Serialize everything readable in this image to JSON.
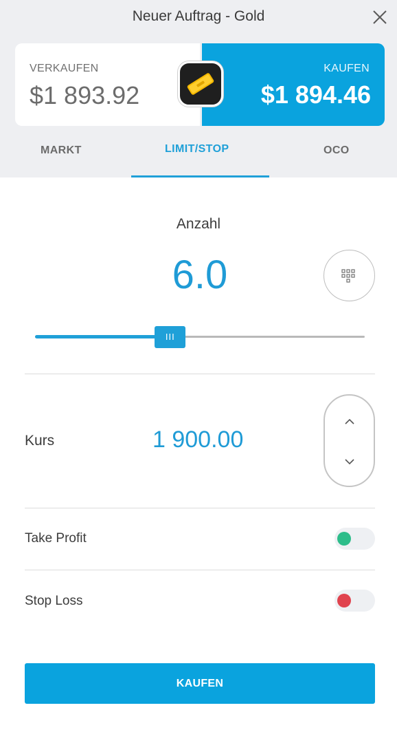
{
  "header": {
    "title": "Neuer Auftrag - Gold"
  },
  "prices": {
    "sell_label": "VERKAUFEN",
    "sell_price": "$1 893.92",
    "buy_label": "KAUFEN",
    "buy_price": "$1 894.46"
  },
  "tabs": [
    {
      "label": "MARKT"
    },
    {
      "label": "LIMIT/STOP",
      "active": true
    },
    {
      "label": "OCO"
    }
  ],
  "quantity": {
    "label": "Anzahl",
    "value": "6.0",
    "slider_fraction": 0.41,
    "thumb_glyph": "III"
  },
  "rate": {
    "label": "Kurs",
    "value": "1 900.00"
  },
  "take_profit": {
    "label": "Take Profit",
    "indicator_color": "#2dbd8a"
  },
  "stop_loss": {
    "label": "Stop Loss",
    "indicator_color": "#e0434e"
  },
  "submit": {
    "label": "KAUFEN"
  },
  "colors": {
    "accent": "#0aa3de",
    "value_blue": "#1f9bd6"
  },
  "icons": {
    "close": "close-icon",
    "gold": "gold-bar-icon",
    "keypad": "keypad-icon",
    "up": "chevron-up-icon",
    "down": "chevron-down-icon"
  }
}
